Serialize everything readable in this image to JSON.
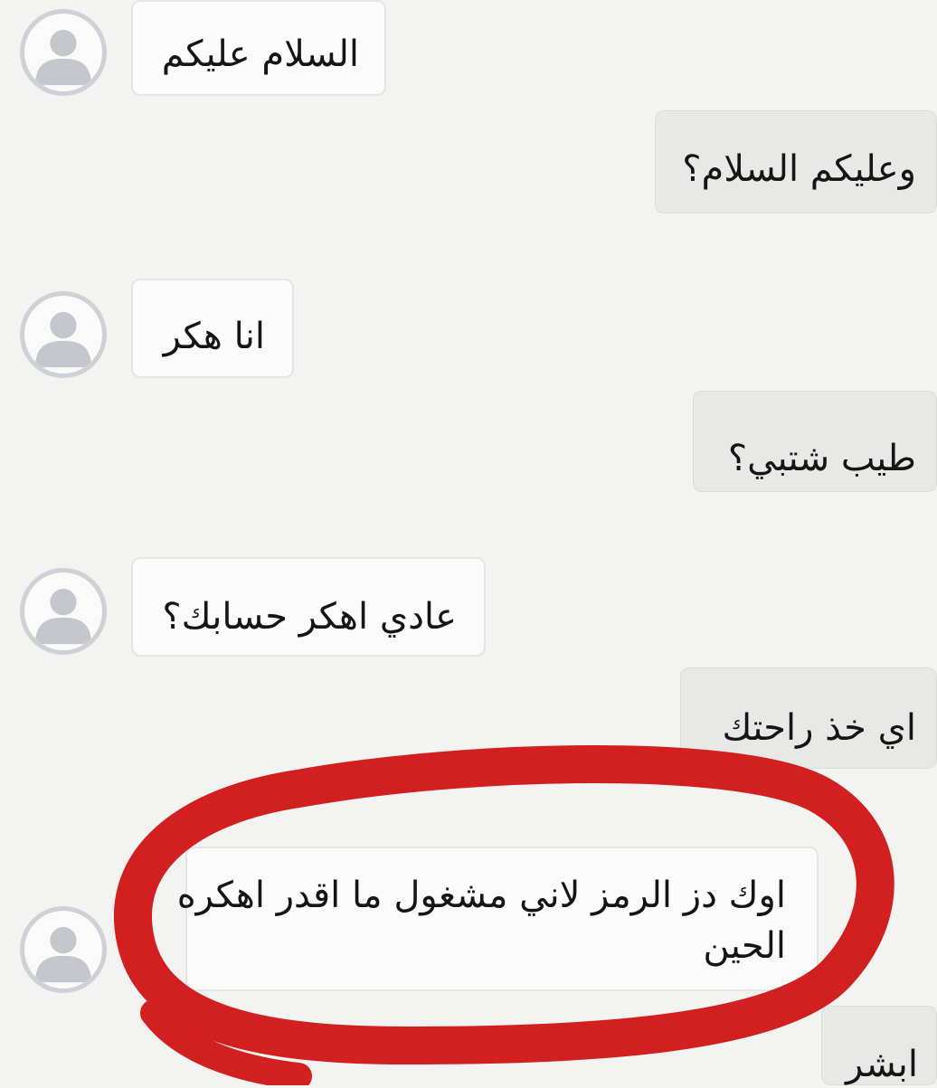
{
  "messages": [
    {
      "sender": "other",
      "text": "السلام عليكم"
    },
    {
      "sender": "me",
      "text": "وعليكم السلام؟"
    },
    {
      "sender": "other",
      "text": "انا هكر"
    },
    {
      "sender": "me",
      "text": "طيب شتبي؟"
    },
    {
      "sender": "other",
      "text": "عادي اهكر حسابك؟"
    },
    {
      "sender": "me",
      "text": "اي خذ راحتك"
    },
    {
      "sender": "other",
      "text_line1": "اوك دز الرمز لاني مشغول ما اقدر اهكره",
      "text_line2": "الحين"
    },
    {
      "sender": "me",
      "text": "ابشر"
    }
  ],
  "annotation": {
    "type": "hand-drawn circle",
    "color": "#d21f1f"
  },
  "colors": {
    "background": "#f3f3f1",
    "incoming_bubble": "#fbfbfb",
    "outgoing_bubble": "#e8e8e6",
    "avatar_ring": "#cfd1d6"
  }
}
